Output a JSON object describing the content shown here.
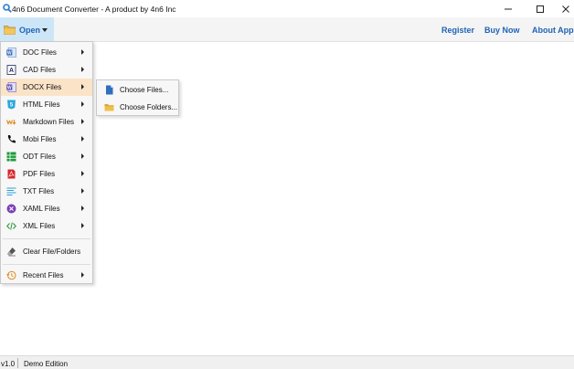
{
  "window": {
    "title": "4n6 Document Converter - A product by 4n6 Inc"
  },
  "toolbar": {
    "open_label": "Open",
    "register_label": "Register",
    "buy_label": "Buy Now",
    "about_label": "About App"
  },
  "menu": {
    "items": [
      {
        "label": "DOC Files",
        "icon": "doc-icon"
      },
      {
        "label": "CAD Files",
        "icon": "cad-icon"
      },
      {
        "label": "DOCX Files",
        "icon": "docx-icon"
      },
      {
        "label": "HTML Files",
        "icon": "html-icon"
      },
      {
        "label": "Markdown Files",
        "icon": "markdown-icon"
      },
      {
        "label": "Mobi Files",
        "icon": "mobi-icon"
      },
      {
        "label": "ODT Files",
        "icon": "odt-icon"
      },
      {
        "label": "PDF Files",
        "icon": "pdf-icon"
      },
      {
        "label": "TXT Files",
        "icon": "txt-icon"
      },
      {
        "label": "XAML Files",
        "icon": "xaml-icon"
      },
      {
        "label": "XML Files",
        "icon": "xml-icon"
      }
    ],
    "clear_label": "Clear File/Folders",
    "recent_label": "Recent Files"
  },
  "submenu": {
    "choose_files_label": "Choose Files...",
    "choose_folders_label": "Choose Folders..."
  },
  "status": {
    "version": "v1.0",
    "edition": "Demo Edition"
  },
  "colors": {
    "accent": "#1e63b6",
    "open_button_bg": "#cde6f7",
    "menu_hover": "#fbe3c8"
  }
}
